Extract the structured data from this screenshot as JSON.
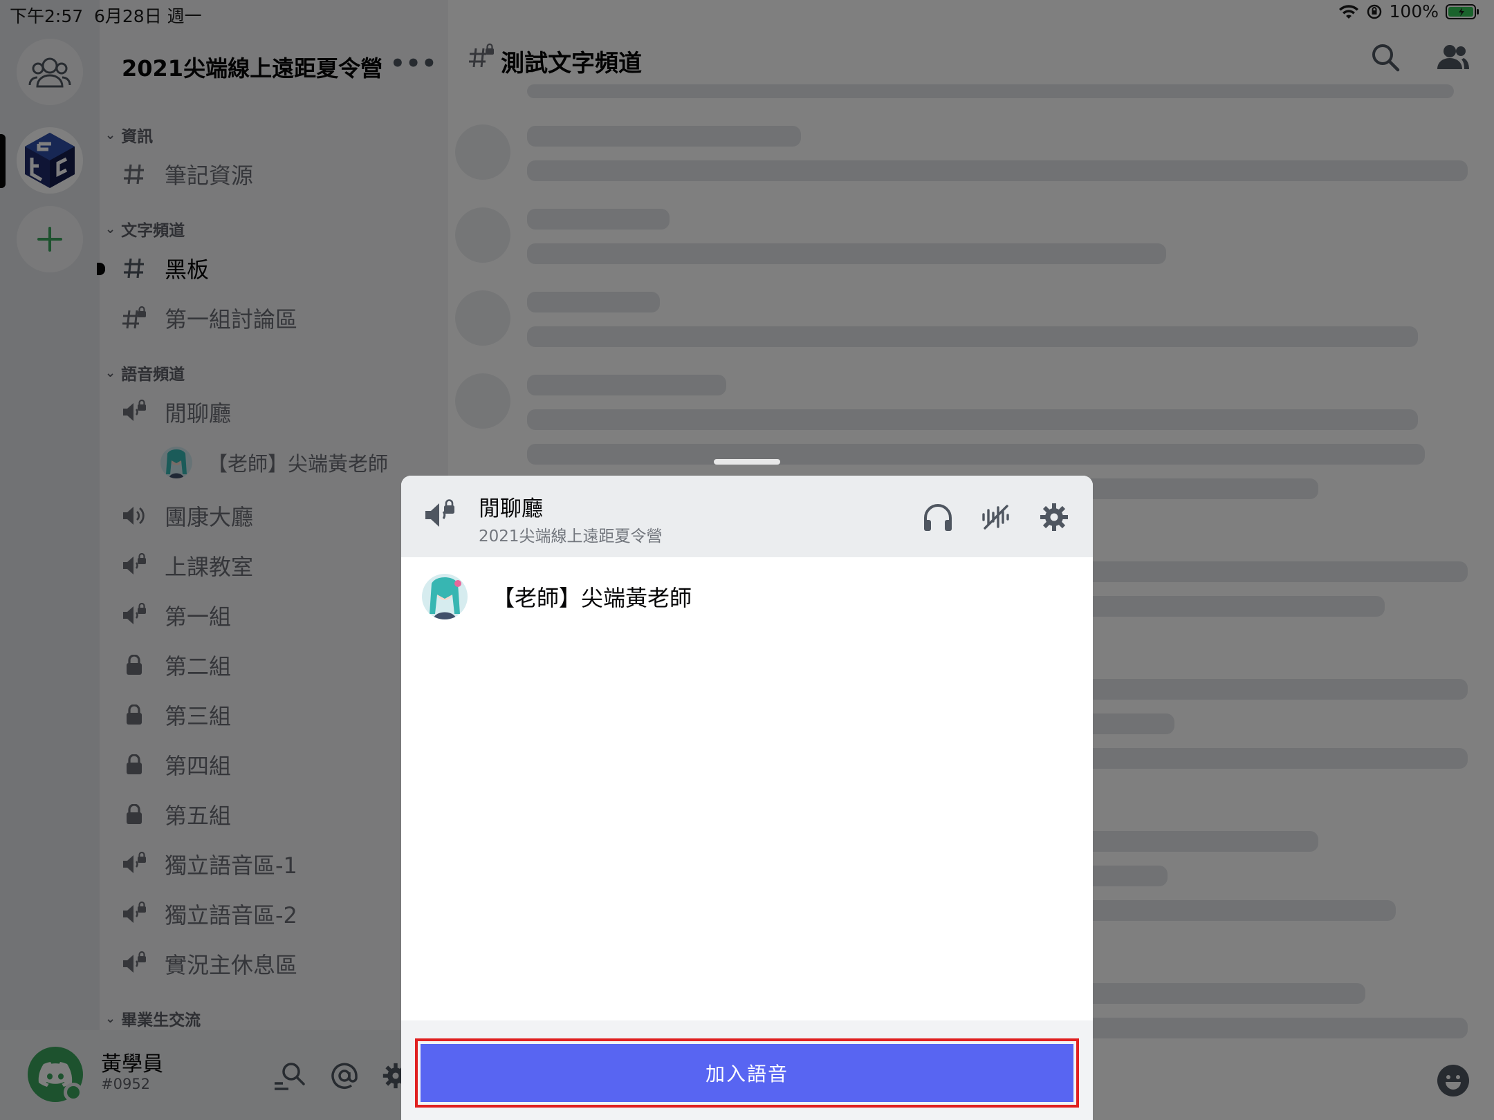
{
  "status_bar": {
    "time": "下午2:57",
    "date": "6月28日 週一",
    "battery": "100%"
  },
  "server": {
    "name": "2021尖端線上遠距夏令營",
    "more": "•••"
  },
  "categories": {
    "info": "資訊",
    "text": "文字頻道",
    "voice": "語音頻道",
    "alumni": "畢業生交流"
  },
  "channels": {
    "notes": "筆記資源",
    "blackboard": "黑板",
    "group1_discussion": "第一組討論區",
    "lounge": "閒聊廳",
    "lounge_user": "【老師】尖端黃老師",
    "hall": "團康大廳",
    "classroom": "上課教室",
    "g1": "第一組",
    "g2": "第二組",
    "g3": "第三組",
    "g4": "第四組",
    "g5": "第五組",
    "solo1": "獨立語音區-1",
    "solo2": "獨立語音區-2",
    "streamer": "實況主休息區"
  },
  "user_panel": {
    "name": "黃學員",
    "tag": "#0952"
  },
  "chat": {
    "title": "測試文字頻道"
  },
  "sheet": {
    "title": "閒聊廳",
    "subtitle": "2021尖端線上遠距夏令營",
    "member": "【老師】尖端黃老師",
    "join_label": "加入語音"
  },
  "colors": {
    "blurple": "#5865f2",
    "highlight_outline": "#e02020",
    "online_green": "#3ba55c"
  },
  "icons": [
    "users-icon",
    "hash-icon",
    "hash-lock-icon",
    "speaker-icon",
    "speaker-lock-icon",
    "lock-icon",
    "headphones-icon",
    "voice-settings-icon",
    "gear-icon",
    "search-icon",
    "members-icon",
    "mention-icon",
    "emoji-icon",
    "discord-logo-icon",
    "plus-icon",
    "wifi-icon",
    "battery-icon"
  ]
}
